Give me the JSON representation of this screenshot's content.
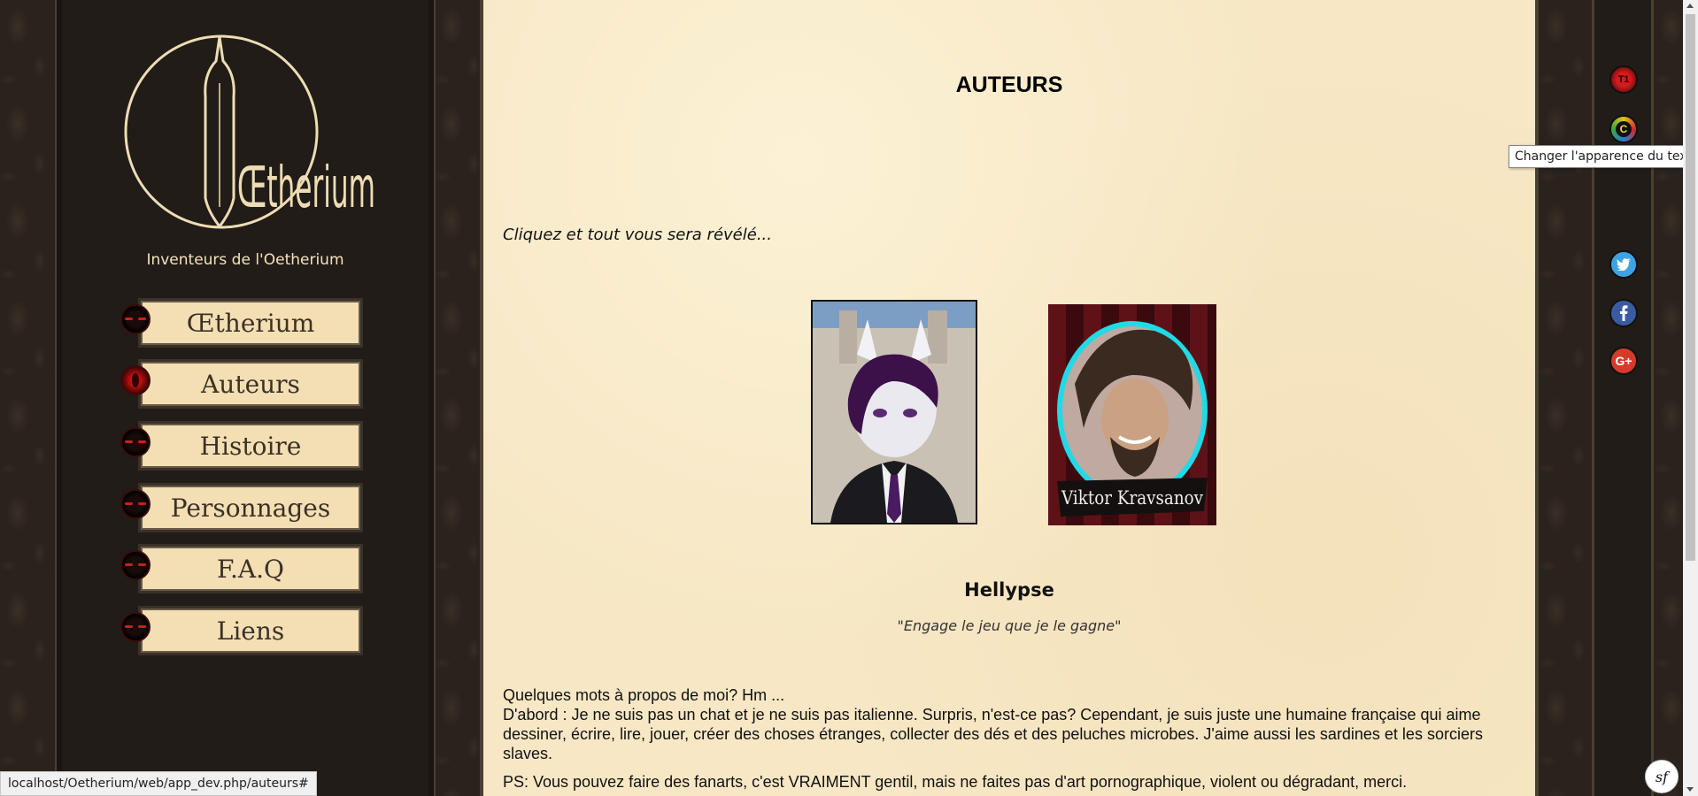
{
  "site": {
    "logo_text": "Œtherium",
    "tagline": "Inventeurs de l'Oetherium"
  },
  "nav": {
    "items": [
      {
        "label": "Œtherium",
        "active": false
      },
      {
        "label": "Auteurs",
        "active": true
      },
      {
        "label": "Histoire",
        "active": false
      },
      {
        "label": "Personnages",
        "active": false
      },
      {
        "label": "F.A.Q",
        "active": false
      },
      {
        "label": "Liens",
        "active": false
      }
    ]
  },
  "main": {
    "title": "AUTEURS",
    "intro": "Cliquez et tout vous sera révélé...",
    "portraits": [
      {
        "name": "Hellypse"
      },
      {
        "name": "Viktor Kravsanov",
        "caption": "Viktor Kravsanov"
      }
    ],
    "author": {
      "name": "Hellypse",
      "quote": "\"Engage le jeu que je le gagne\"",
      "bio_line1": "Quelques mots à propos de moi? Hm ...",
      "bio_para": "D'abord : Je ne suis pas un chat et je ne suis pas italienne. Surpris, n'est-ce pas? Cependant, je suis juste une humaine française qui aime dessiner, écrire, lire, jouer, créer des choses étranges, collecter des dés et des peluches microbes. J'aime aussi les sardines et les sorciers slaves.",
      "ps": "PS: Vous pouvez faire des fanarts, c'est VRAIMENT gentil, mais ne faites pas d'art pornographique, violent ou dégradant, merci."
    }
  },
  "side_buttons": {
    "font_label": "T1",
    "color_label": "C",
    "twitter_icon": "twitter-icon",
    "facebook_icon": "facebook-icon",
    "gplus_label": "G+"
  },
  "tooltip": "Changer l'apparence du texte",
  "status_bar_url": "localhost/Oetherium/web/app_dev.php/auteurs#",
  "colors": {
    "parchment": "#f7e7c4",
    "sidebar": "#211c17",
    "nav_button": "#f3dfb3"
  }
}
